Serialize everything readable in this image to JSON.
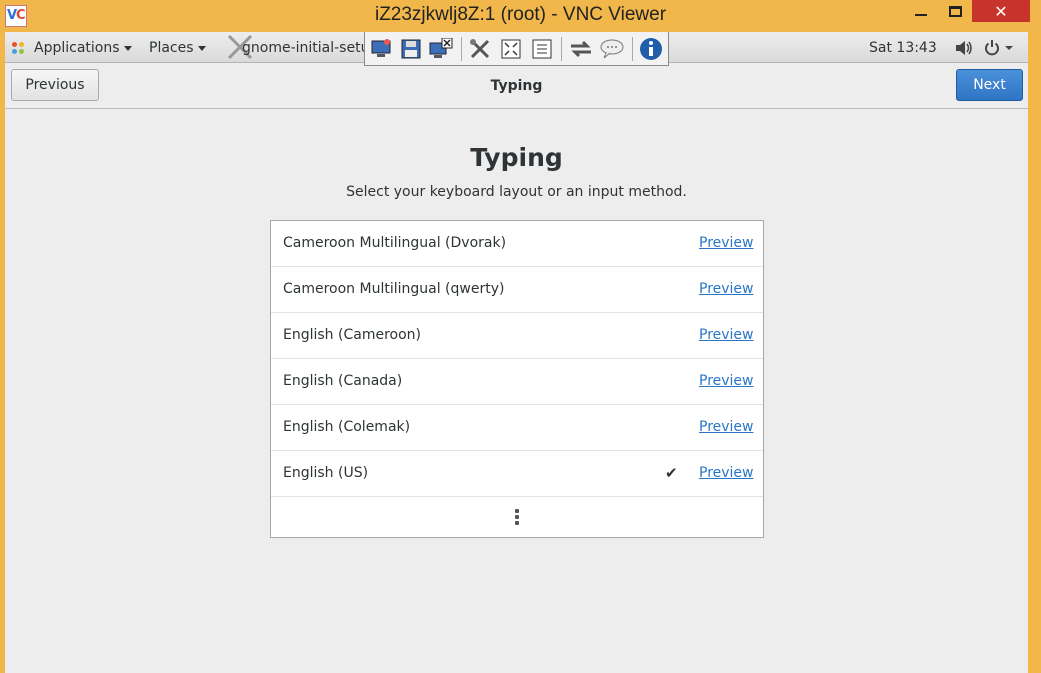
{
  "window": {
    "title": "iZ23zjkwlj8Z:1 (root) - VNC Viewer",
    "close_glyph": "✕"
  },
  "topbar": {
    "applications_label": "Applications",
    "places_label": "Places",
    "window_title": "gnome-initial-setup",
    "clock": "Sat 13:43"
  },
  "header": {
    "previous_label": "Previous",
    "title": "Typing",
    "next_label": "Next"
  },
  "page": {
    "title": "Typing",
    "subtitle": "Select your keyboard layout or an input method."
  },
  "layouts": [
    {
      "label": "Cameroon Multilingual (Dvorak)",
      "preview": "Preview",
      "selected": false
    },
    {
      "label": "Cameroon Multilingual (qwerty)",
      "preview": "Preview",
      "selected": false
    },
    {
      "label": "English (Cameroon)",
      "preview": "Preview",
      "selected": false
    },
    {
      "label": "English (Canada)",
      "preview": "Preview",
      "selected": false
    },
    {
      "label": "English (Colemak)",
      "preview": "Preview",
      "selected": false
    },
    {
      "label": "English (US)",
      "preview": "Preview",
      "selected": true,
      "check": "✔"
    }
  ],
  "colors": {
    "window_frame": "#f1b74a",
    "accent": "#2f75c5",
    "link": "#2a76c6",
    "close": "#c7342b"
  },
  "icons": [
    "vnc-logo-icon",
    "minimize-icon",
    "maximize-icon",
    "close-icon",
    "applications-icon",
    "screen-icon",
    "save-icon",
    "disconnect-icon",
    "options-icon",
    "fullscreen-icon",
    "ctrl-alt-del-icon",
    "transfer-icon",
    "chat-icon",
    "info-icon",
    "volume-icon",
    "power-icon",
    "more-icon",
    "checkmark-icon"
  ]
}
